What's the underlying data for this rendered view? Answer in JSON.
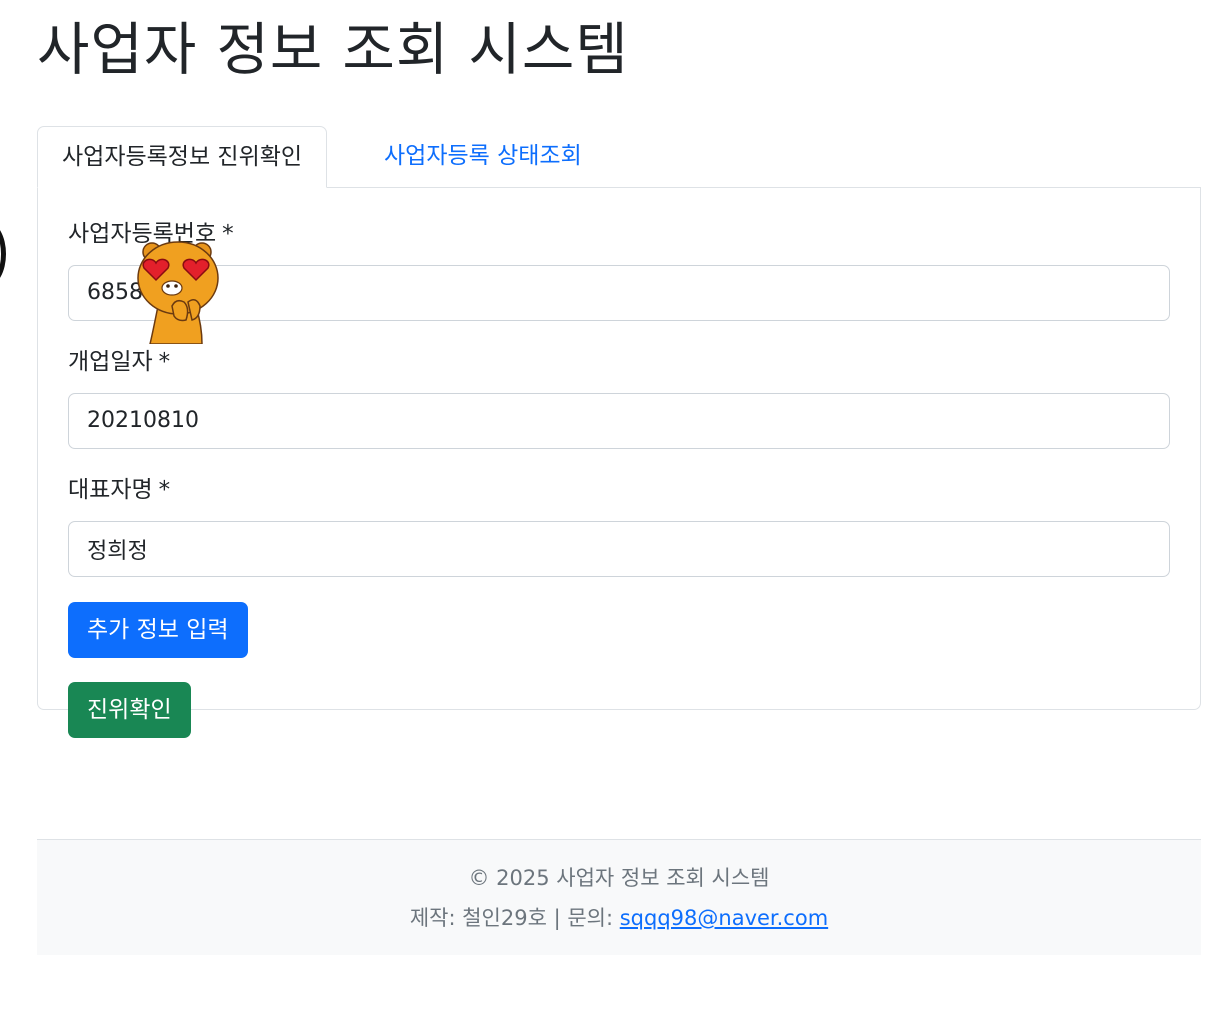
{
  "page": {
    "title": "사업자 정보 조회 시스템"
  },
  "tabs": [
    {
      "label": "사업자등록정보 진위확인",
      "active": true
    },
    {
      "label": "사업자등록 상태조회",
      "active": false
    }
  ],
  "form": {
    "business_number": {
      "label": "사업자등록번호",
      "required_mark": "*",
      "value": "6858"
    },
    "open_date": {
      "label": "개업일자",
      "required_mark": "*",
      "value": "20210810"
    },
    "representative": {
      "label": "대표자명",
      "required_mark": "*",
      "value": "정희정"
    },
    "add_info_button": "추가 정보 입력",
    "verify_button": "진위확인"
  },
  "overlay": {
    "sticker": "ryan-heart-eyes-icon"
  },
  "footer": {
    "copyright": "© 2025 사업자 정보 조회 시스템",
    "credit_prefix": "제작: 철인29호 | 문의: ",
    "email": "sqqq98@naver.com"
  },
  "colors": {
    "primary": "#0d6efd",
    "success": "#198754",
    "footer_bg": "#f8f9fa",
    "border": "#dee2e6"
  }
}
